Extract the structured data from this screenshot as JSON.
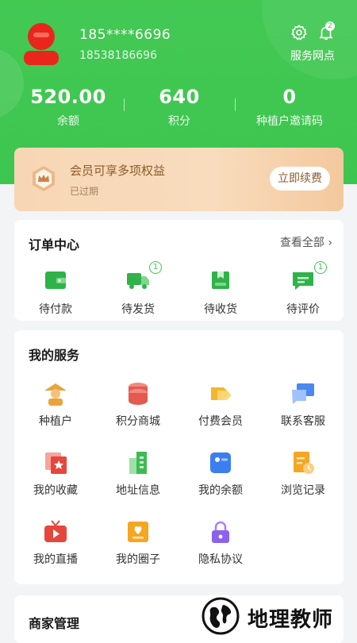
{
  "user": {
    "phone_masked": "185****6696",
    "phone_full": "18538186696"
  },
  "header": {
    "service_point_label": "服务网点",
    "bell_badge": "2"
  },
  "stats": [
    {
      "value": "520.00",
      "label": "余额"
    },
    {
      "value": "640",
      "label": "积分"
    },
    {
      "value": "0",
      "label": "种植户邀请码"
    }
  ],
  "vip": {
    "title": "会员可享多项权益",
    "status": "已过期",
    "button": "立即续费"
  },
  "orders": {
    "title": "订单中心",
    "view_all": "查看全部",
    "items": [
      {
        "label": "待付款",
        "icon": "wallet-icon",
        "badge": ""
      },
      {
        "label": "待发货",
        "icon": "truck-icon",
        "badge": "1"
      },
      {
        "label": "待收货",
        "icon": "package-icon",
        "badge": ""
      },
      {
        "label": "待评价",
        "icon": "comment-icon",
        "badge": "1"
      }
    ]
  },
  "services": {
    "title": "我的服务",
    "items": [
      {
        "label": "种植户",
        "icon": "farmer-icon"
      },
      {
        "label": "积分商城",
        "icon": "coins-icon"
      },
      {
        "label": "付费会员",
        "icon": "vip-tag-icon"
      },
      {
        "label": "联系客服",
        "icon": "chat-icon"
      },
      {
        "label": "我的收藏",
        "icon": "star-icon"
      },
      {
        "label": "地址信息",
        "icon": "building-icon"
      },
      {
        "label": "我的余额",
        "icon": "balance-icon"
      },
      {
        "label": "浏览记录",
        "icon": "history-icon"
      },
      {
        "label": "我的直播",
        "icon": "tv-icon"
      },
      {
        "label": "我的圈子",
        "icon": "heart-card-icon"
      },
      {
        "label": "隐私协议",
        "icon": "lock-icon"
      }
    ]
  },
  "merchant": {
    "title": "商家管理"
  },
  "watermark": {
    "text": "地理教师"
  },
  "colors": {
    "brand": "#3dc64f",
    "vip_gold": "#8b5b2a"
  }
}
